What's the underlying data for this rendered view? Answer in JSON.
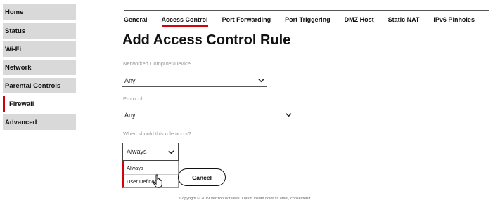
{
  "sidebar": {
    "items": [
      {
        "label": "Home",
        "active": false
      },
      {
        "label": "Status",
        "active": false
      },
      {
        "label": "Wi-Fi",
        "active": false
      },
      {
        "label": "Network",
        "active": false
      },
      {
        "label": "Parental Controls",
        "active": false
      },
      {
        "label": "Firewall",
        "active": true
      },
      {
        "label": "Advanced",
        "active": false
      }
    ]
  },
  "tabs": [
    {
      "label": "General",
      "active": false
    },
    {
      "label": "Access Control",
      "active": true
    },
    {
      "label": "Port Forwarding",
      "active": false
    },
    {
      "label": "Port Triggering",
      "active": false
    },
    {
      "label": "DMZ Host",
      "active": false
    },
    {
      "label": "Static NAT",
      "active": false
    },
    {
      "label": "IPv6 Pinholes",
      "active": false
    }
  ],
  "page_title": "Add Access Control Rule",
  "form": {
    "computer_label": "Networked Computer/Device",
    "computer_value": "Any",
    "protocol_label": "Protocol",
    "protocol_value": "Any",
    "when_label": "When should this rule occur?",
    "when_value": "Always",
    "when_options": [
      "Always",
      "User Defined"
    ]
  },
  "buttons": {
    "cancel": "Cancel"
  },
  "footer": "Copyright © 2019 Verizon Wireless. Lorem ipsum dolor sit amet, consectetur..."
}
